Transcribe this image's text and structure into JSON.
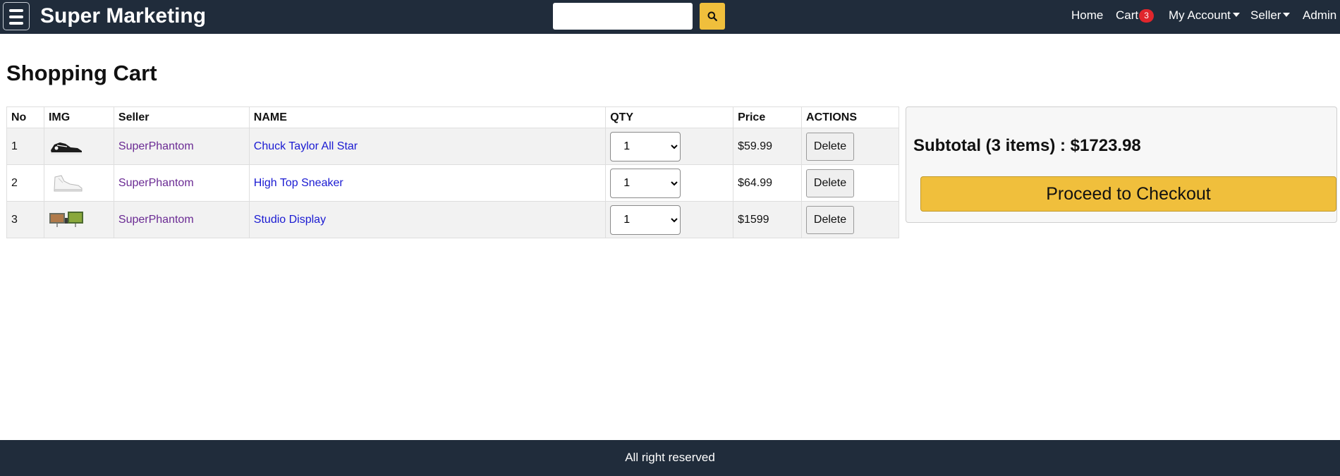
{
  "navbar": {
    "brand": "Super Marketing",
    "search": {
      "placeholder": "",
      "value": ""
    },
    "links": {
      "home": "Home",
      "cart": "Cart",
      "cart_count": "3",
      "my_account": "My Account",
      "seller": "Seller",
      "admin": "Admin"
    },
    "icons": {
      "menu": "hamburger-icon",
      "search": "search-icon",
      "dropdown": "caret-down-icon"
    }
  },
  "page": {
    "title": "Shopping Cart"
  },
  "cart_table": {
    "headers": {
      "no": "No",
      "img": "IMG",
      "seller": "Seller",
      "name": "NAME",
      "qty": "QTY",
      "price": "Price",
      "actions": "ACTIONS"
    },
    "rows": [
      {
        "no": "1",
        "image": "black-sneaker-thumbnail",
        "seller": "SuperPhantom",
        "name": "Chuck Taylor All Star",
        "qty": "1",
        "price": "$59.99",
        "action": "Delete"
      },
      {
        "no": "2",
        "image": "white-sneaker-thumbnail",
        "seller": "SuperPhantom",
        "name": "High Top Sneaker",
        "qty": "1",
        "price": "$64.99",
        "action": "Delete"
      },
      {
        "no": "3",
        "image": "monitor-thumbnail",
        "seller": "SuperPhantom",
        "name": "Studio Display",
        "qty": "1",
        "price": "$1599",
        "action": "Delete"
      }
    ]
  },
  "summary": {
    "subtotal": "Subtotal (3 items) : $1723.98",
    "checkout_label": "Proceed to Checkout"
  },
  "footer": {
    "text": "All right reserved"
  },
  "colors": {
    "navbar": "#202c3b",
    "accent": "#f0bf3c",
    "badge": "#e0262c",
    "seller_link": "#6a2a93",
    "name_link": "#1a1ad2"
  }
}
